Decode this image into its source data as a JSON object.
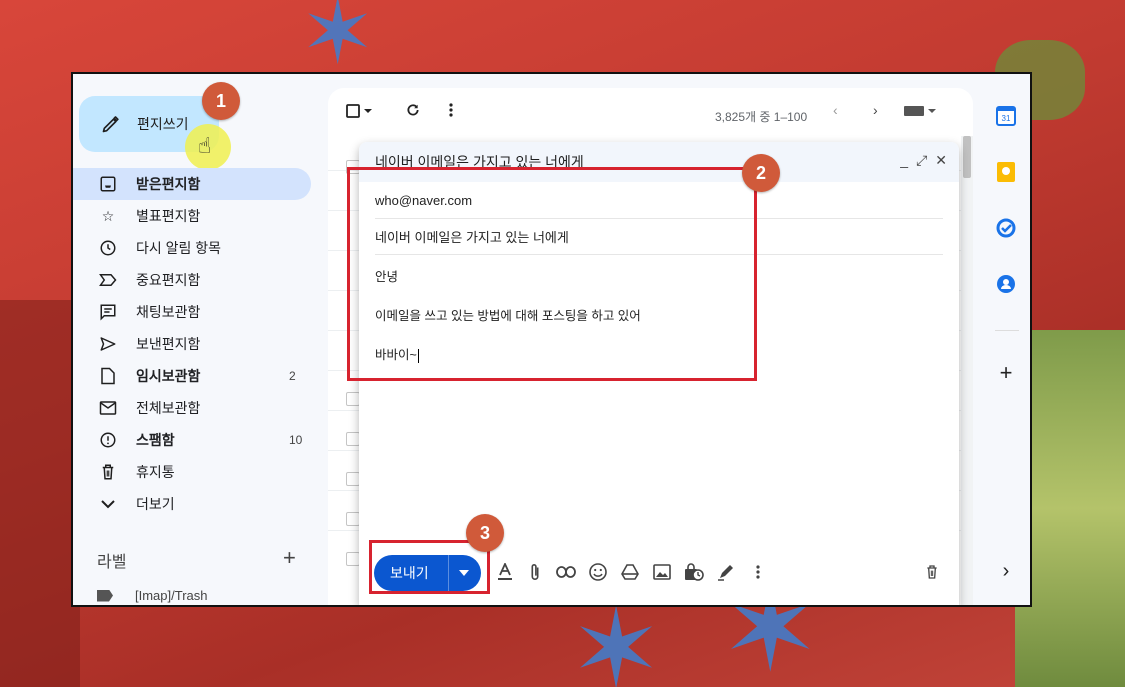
{
  "compose_button": {
    "label": "편지쓰기"
  },
  "nav": {
    "items": [
      {
        "label": "받은편지함",
        "count": "",
        "icon": "inbox-icon"
      },
      {
        "label": "별표편지함",
        "count": "",
        "icon": "star-icon"
      },
      {
        "label": "다시 알림 항목",
        "count": "",
        "icon": "clock-icon"
      },
      {
        "label": "중요편지함",
        "count": "",
        "icon": "important-icon"
      },
      {
        "label": "채팅보관함",
        "count": "",
        "icon": "chat-icon"
      },
      {
        "label": "보낸편지함",
        "count": "",
        "icon": "send-icon"
      },
      {
        "label": "임시보관함",
        "count": "2",
        "icon": "draft-icon"
      },
      {
        "label": "전체보관함",
        "count": "",
        "icon": "mail-icon"
      },
      {
        "label": "스팸함",
        "count": "10",
        "icon": "spam-icon"
      },
      {
        "label": "휴지통",
        "count": "",
        "icon": "trash-icon"
      },
      {
        "label": "더보기",
        "count": "",
        "icon": "chevron-down-icon"
      }
    ]
  },
  "labels": {
    "heading": "라벨",
    "add": "+",
    "first": "[Imap]/Trash"
  },
  "list_toolbar": {
    "range": "3,825개 중 1–100"
  },
  "compose": {
    "title": "네이버 이메일은 가지고 있는 너에게",
    "to": "who@naver.com",
    "subject": "네이버 이메일은 가지고 있는 너에게",
    "body_lines": [
      "안녕",
      "이메일을 쓰고 있는 방법에 대해 포스팅을 하고 있어",
      "바바이~"
    ],
    "send_label": "보내기",
    "window_controls": [
      "_",
      "⤢",
      "✕"
    ]
  },
  "annotations": {
    "badge1": "1",
    "badge2": "2",
    "badge3": "3"
  },
  "colors": {
    "send": "#0b57d0",
    "compose_highlight": "#c2e7ff",
    "active_nav": "#d3e3fd",
    "annotation_red": "#d7232f",
    "badge": "#d05a3a"
  }
}
